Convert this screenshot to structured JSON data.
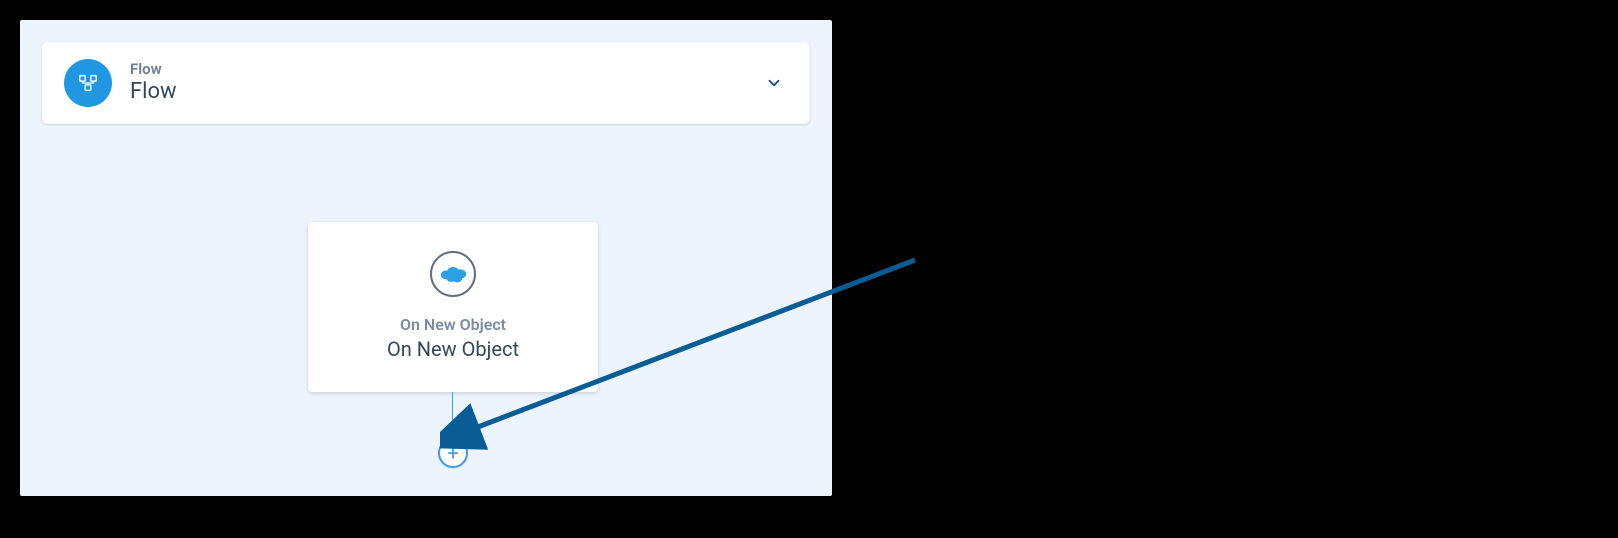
{
  "header": {
    "label": "Flow",
    "title": "Flow"
  },
  "node": {
    "label": "On New Object",
    "title": "On New Object",
    "icon": "salesforce"
  },
  "addButton": {
    "symbol": "+"
  },
  "colors": {
    "canvasBg": "#ecf4fd",
    "primaryBlue": "#1f97e3",
    "arrowBlue": "#0a5c94",
    "textMuted": "#7a8ba3",
    "textDark": "#33475b"
  }
}
